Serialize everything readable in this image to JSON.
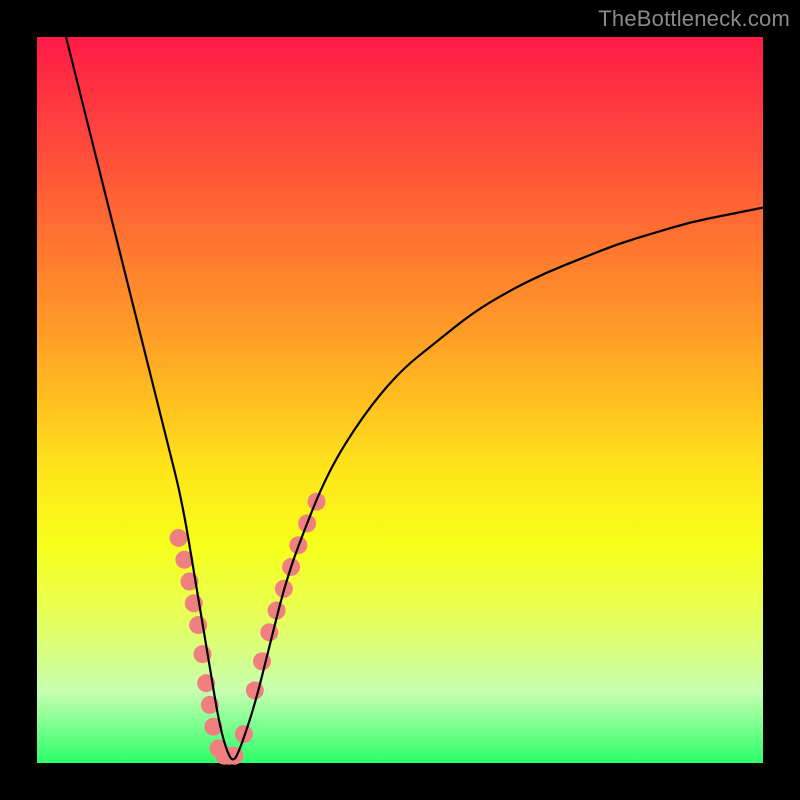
{
  "watermark": "TheBottleneck.com",
  "chart_data": {
    "type": "line",
    "title": "",
    "xlabel": "",
    "ylabel": "",
    "xlim": [
      0,
      100
    ],
    "ylim": [
      0,
      100
    ],
    "series": [
      {
        "name": "bottleneck-curve",
        "x": [
          4,
          6,
          8,
          10,
          12,
          14,
          16,
          18,
          20,
          22,
          23,
          24,
          25,
          26,
          27,
          28,
          30,
          32,
          34,
          36,
          40,
          45,
          50,
          55,
          60,
          65,
          70,
          75,
          80,
          85,
          90,
          95,
          100
        ],
        "y": [
          100,
          92,
          84,
          76,
          68,
          60,
          52,
          44,
          36,
          24,
          18,
          12,
          6,
          2,
          0,
          2,
          8,
          16,
          24,
          30,
          40,
          48,
          54,
          58,
          62,
          65,
          67.5,
          69.5,
          71.5,
          73,
          74.5,
          75.5,
          76.5
        ]
      }
    ],
    "markers": {
      "name": "highlight-points",
      "color": "#f08080",
      "radius_px": 9,
      "x": [
        19.5,
        20.3,
        21.0,
        21.6,
        22.2,
        22.8,
        23.3,
        23.8,
        24.3,
        25.0,
        25.8,
        26.5,
        27.2,
        28.5,
        30.0,
        31.0,
        32.0,
        33.0,
        34.0,
        35.0,
        36.0,
        37.2,
        38.5
      ],
      "y": [
        31,
        28,
        25,
        22,
        19,
        15,
        11,
        8,
        5,
        2,
        1,
        1,
        1,
        4,
        10,
        14,
        18,
        21,
        24,
        27,
        30,
        33,
        36
      ]
    },
    "legend": [],
    "grid": false
  }
}
